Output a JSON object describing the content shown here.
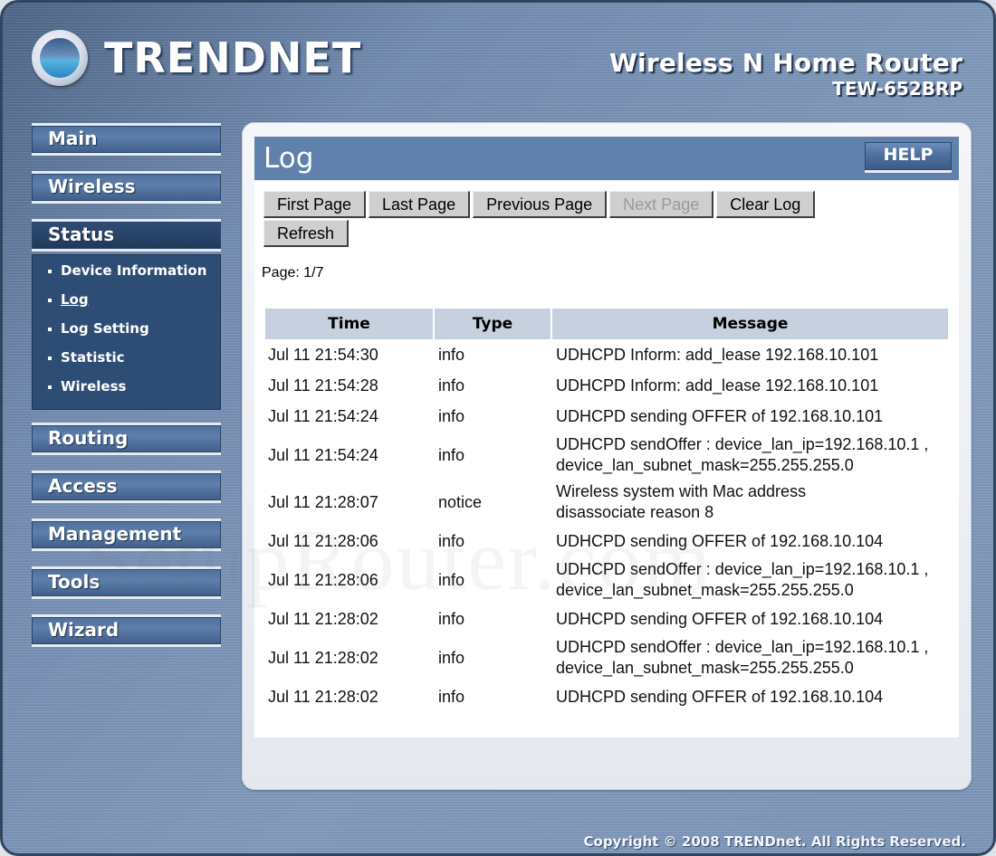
{
  "header": {
    "brand": "TRENDnet",
    "product_name": "Wireless N Home Router",
    "product_model": "TEW-652BRP"
  },
  "sidebar": {
    "items": [
      {
        "label": "Main"
      },
      {
        "label": "Wireless"
      },
      {
        "label": "Status",
        "active": true,
        "sub_items": [
          {
            "label": "Device Information"
          },
          {
            "label": "Log",
            "current": true
          },
          {
            "label": "Log Setting"
          },
          {
            "label": "Statistic"
          },
          {
            "label": "Wireless"
          }
        ]
      },
      {
        "label": "Routing"
      },
      {
        "label": "Access"
      },
      {
        "label": "Management"
      },
      {
        "label": "Tools"
      },
      {
        "label": "Wizard"
      }
    ]
  },
  "panel": {
    "title": "Log",
    "help_label": "HELP",
    "buttons": {
      "first_page": "First Page",
      "last_page": "Last Page",
      "previous_page": "Previous Page",
      "next_page": "Next Page",
      "clear_log": "Clear Log",
      "refresh": "Refresh"
    },
    "page_info": "Page: 1/7",
    "table": {
      "headers": [
        "Time",
        "Type",
        "Message"
      ],
      "rows": [
        {
          "time": "Jul 11 21:54:30",
          "type": "info",
          "message": "UDHCPD Inform: add_lease 192.168.10.101"
        },
        {
          "time": "Jul 11 21:54:28",
          "type": "info",
          "message": "UDHCPD Inform: add_lease 192.168.10.101"
        },
        {
          "time": "Jul 11 21:54:24",
          "type": "info",
          "message": "UDHCPD sending OFFER of 192.168.10.101"
        },
        {
          "time": "Jul 11 21:54:24",
          "type": "info",
          "message": "UDHCPD sendOffer : device_lan_ip=192.168.10.1 ,\ndevice_lan_subnet_mask=255.255.255.0"
        },
        {
          "time": "Jul 11 21:28:07",
          "type": "notice",
          "message": "Wireless system with Mac address\n                              disassociate reason 8"
        },
        {
          "time": "Jul 11 21:28:06",
          "type": "info",
          "message": "UDHCPD sending OFFER of 192.168.10.104"
        },
        {
          "time": "Jul 11 21:28:06",
          "type": "info",
          "message": "UDHCPD sendOffer : device_lan_ip=192.168.10.1 ,\ndevice_lan_subnet_mask=255.255.255.0"
        },
        {
          "time": "Jul 11 21:28:02",
          "type": "info",
          "message": "UDHCPD sending OFFER of 192.168.10.104"
        },
        {
          "time": "Jul 11 21:28:02",
          "type": "info",
          "message": "UDHCPD sendOffer : device_lan_ip=192.168.10.1 ,\ndevice_lan_subnet_mask=255.255.255.0"
        },
        {
          "time": "Jul 11 21:28:02",
          "type": "info",
          "message": "UDHCPD sending OFFER of 192.168.10.104"
        }
      ]
    }
  },
  "watermark": "SetupRouter.com",
  "footer": {
    "copyright": "Copyright © 2008 TRENDnet. All Rights Reserved."
  }
}
